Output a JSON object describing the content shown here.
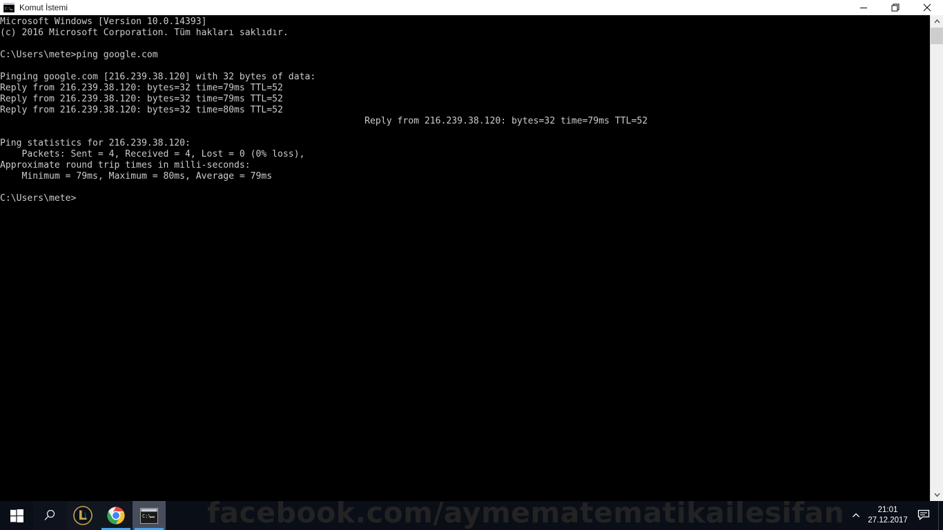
{
  "window": {
    "title": "Komut İstemi",
    "icon": "cmd-icon",
    "controls": {
      "minimize": "minimize-icon",
      "restore": "restore-icon",
      "close": "close-icon"
    },
    "background": "#000000",
    "text_color": "#cccccc"
  },
  "console": {
    "lines": [
      {
        "text": "Microsoft Windows [Version 10.0.14393]",
        "indent": 0
      },
      {
        "text": "(c) 2016 Microsoft Corporation. Tüm hakları saklıdır.",
        "indent": 0
      },
      {
        "text": "",
        "indent": 0
      },
      {
        "text": "C:\\Users\\mete>ping google.com",
        "indent": 0
      },
      {
        "text": "",
        "indent": 0
      },
      {
        "text": "Pinging google.com [216.239.38.120] with 32 bytes of data:",
        "indent": 0
      },
      {
        "text": "Reply from 216.239.38.120: bytes=32 time=79ms TTL=52",
        "indent": 0
      },
      {
        "text": "Reply from 216.239.38.120: bytes=32 time=79ms TTL=52",
        "indent": 0
      },
      {
        "text": "Reply from 216.239.38.120: bytes=32 time=80ms TTL=52",
        "indent": 0
      },
      {
        "text": "Reply from 216.239.38.120: bytes=32 time=79ms TTL=52",
        "indent": 67
      },
      {
        "text": "",
        "indent": 0
      },
      {
        "text": "Ping statistics for 216.239.38.120:",
        "indent": 0
      },
      {
        "text": "    Packets: Sent = 4, Received = 4, Lost = 0 (0% loss),",
        "indent": 0
      },
      {
        "text": "Approximate round trip times in milli-seconds:",
        "indent": 0
      },
      {
        "text": "    Minimum = 79ms, Maximum = 80ms, Average = 79ms",
        "indent": 0
      },
      {
        "text": "",
        "indent": 0
      },
      {
        "text": "C:\\Users\\mete>",
        "indent": 0
      }
    ]
  },
  "scrollbar": {
    "up_arrow": "chevron-up-icon",
    "down_arrow": "chevron-down-icon",
    "thumb": "scrollbar-thumb"
  },
  "taskbar": {
    "start": "windows-logo-icon",
    "search": "search-icon",
    "items": [
      {
        "name": "league-of-legends",
        "label": "League of Legends",
        "active": false,
        "running": false
      },
      {
        "name": "google-chrome",
        "label": "Google Chrome",
        "active": false,
        "running": true
      },
      {
        "name": "command-prompt",
        "label": "Komut İstemi",
        "active": true,
        "running": true
      }
    ],
    "watermark": "facebook.com/aymematematikailesifan",
    "tray": {
      "chevron": "chevron-up-icon",
      "time": "21:01",
      "date": "27.12.2017",
      "action_center": "action-center-icon"
    }
  }
}
